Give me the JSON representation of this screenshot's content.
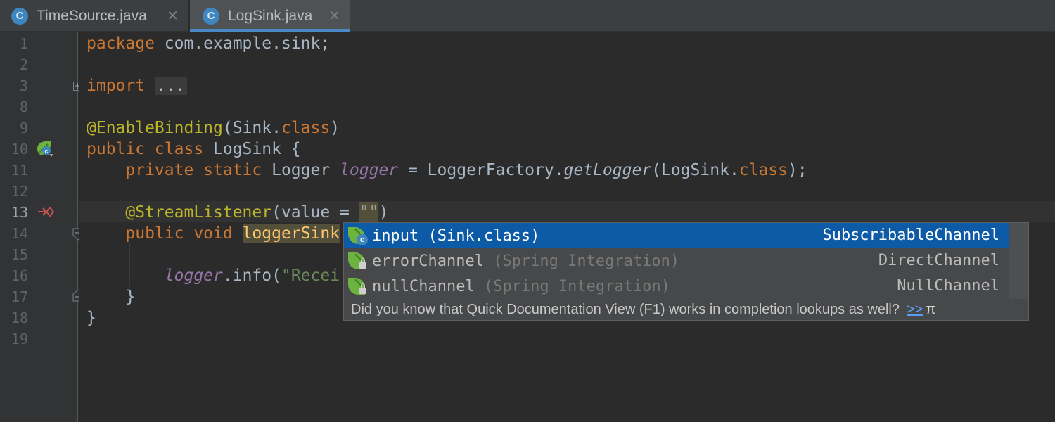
{
  "tabs": [
    {
      "icon": "C",
      "label": "TimeSource.java",
      "close": "✕"
    },
    {
      "icon": "C",
      "label": "LogSink.java",
      "close": "✕"
    }
  ],
  "line_numbers": [
    "1",
    "2",
    "3",
    "8",
    "9",
    "10",
    "11",
    "12",
    "13",
    "14",
    "15",
    "16",
    "17",
    "18",
    "19"
  ],
  "code": {
    "l1_kw": "package",
    "l1_rest": " com.example.sink;",
    "l3_kw": "import",
    "l3_ph": "...",
    "l9_ann": "@EnableBinding",
    "l9_a": "(Sink.",
    "l9_kw": "class",
    "l9_b": ")",
    "l10_kw": "public class",
    "l10_rest": " LogSink {",
    "l11_kw": "private static",
    "l11_a": " Logger ",
    "l11_fld": "logger",
    "l11_b": " = LoggerFactory.",
    "l11_itl": "getLogger",
    "l11_c": "(LogSink.",
    "l11_kw2": "class",
    "l11_d": ");",
    "l13_ann": "@StreamListener",
    "l13_a": "(value = ",
    "l13_ph": "\"\"",
    "l13_b": ")",
    "l14_kw": "public void",
    "l14_method": "loggerSink",
    "l16_fld": "logger",
    "l16_a": ".info(",
    "l16_str": "\"Recei",
    "l17": "}",
    "l18": "}"
  },
  "completion": {
    "items": [
      {
        "name": "input",
        "detail": " (Sink.class)",
        "type": "SubscribableChannel",
        "icon": "spring-channel-icon"
      },
      {
        "name": "errorChannel",
        "detail": " (Spring Integration)",
        "type": "DirectChannel",
        "icon": "spring-locked-icon"
      },
      {
        "name": "nullChannel",
        "detail": " (Spring Integration)",
        "type": "NullChannel",
        "icon": "spring-locked-icon"
      }
    ],
    "hint": "Did you know that Quick Documentation View (F1) works in completion lookups as well?",
    "hint_link": ">>",
    "hint_pi": "π"
  },
  "colors": {
    "accent": "#4a88c7",
    "selection": "#0d5aa7",
    "keyword": "#cc7832",
    "annotation": "#bbb529",
    "field": "#9876aa",
    "string": "#6a8759"
  }
}
